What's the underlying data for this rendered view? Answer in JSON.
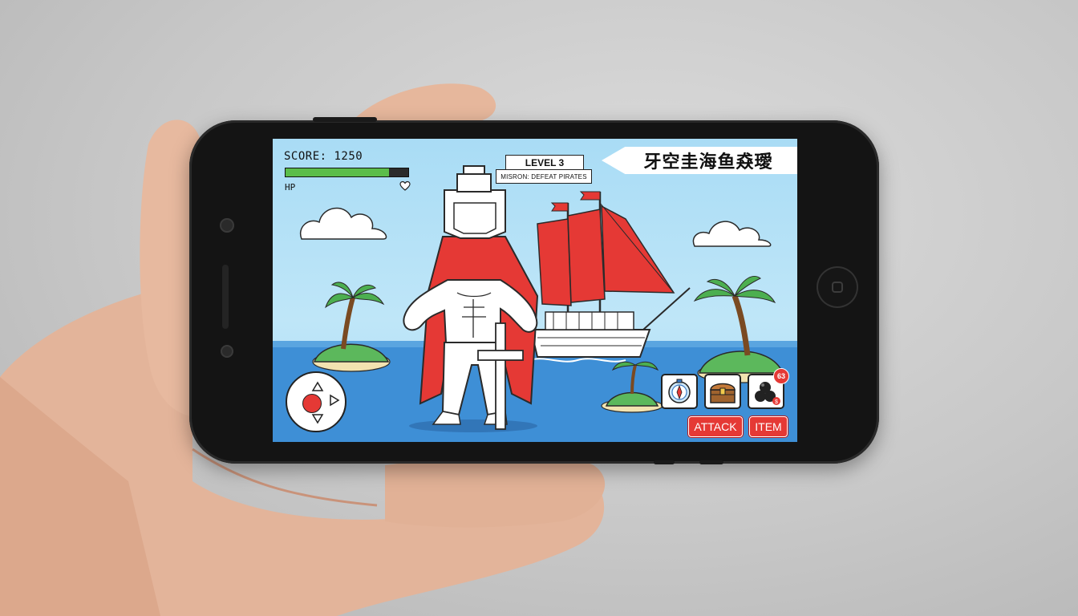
{
  "hud": {
    "score_label": "SCORE: 1250",
    "hp_label": "HP",
    "hp_fraction": 0.84,
    "heart_icon": "heart-icon"
  },
  "mission": {
    "level": "LEVEL 3",
    "objective": "MISRON: DEFEAT PIRATES"
  },
  "title_banner": "牙空圭海鱼猋璦",
  "inventory": {
    "slots": [
      {
        "name": "compass",
        "icon": "compass-icon"
      },
      {
        "name": "treasure-chest",
        "icon": "treasure-chest-icon"
      },
      {
        "name": "cannonballs",
        "icon": "cannonball-icon"
      }
    ],
    "badge_count": "63",
    "currency_symbol": "$"
  },
  "buttons": {
    "attack": "ATTACK",
    "item": "ITEM"
  },
  "colors": {
    "accent_red": "#e53935",
    "hp_green": "#5bbd4a",
    "sky": "#a9dcf5",
    "sea": "#3e8fd6"
  }
}
